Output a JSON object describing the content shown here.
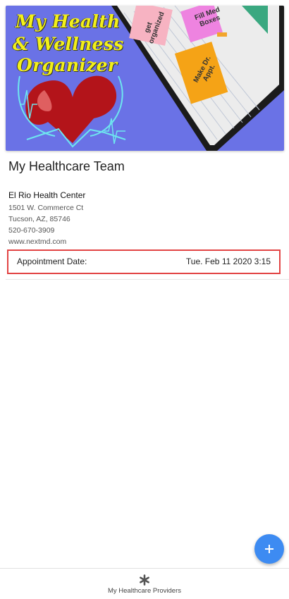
{
  "banner": {
    "title_line1": "My Health",
    "title_line2": "& Wellness",
    "title_line3": "Organizer",
    "note1": "get organized",
    "note2": "Fill Med Boxes",
    "note3": "Make Dr. Appt."
  },
  "page": {
    "title": "My Healthcare Team"
  },
  "provider": {
    "name": "El Rio Health Center",
    "address": "1501 W. Commerce Ct",
    "city": "Tucson, AZ, 85746",
    "phone": "520-670-3909",
    "website": "www.nextmd.com",
    "appointment_label": "Appointment Date:",
    "appointment_value": "Tue. Feb 11 2020 3:15"
  },
  "fab": {
    "icon": "plus-icon"
  },
  "bottom_nav": {
    "label": "My Healthcare Providers",
    "icon": "asterisk-icon"
  },
  "colors": {
    "banner_bg": "#6a72e6",
    "fab": "#3d8bf2",
    "highlight_border": "#e24444"
  }
}
